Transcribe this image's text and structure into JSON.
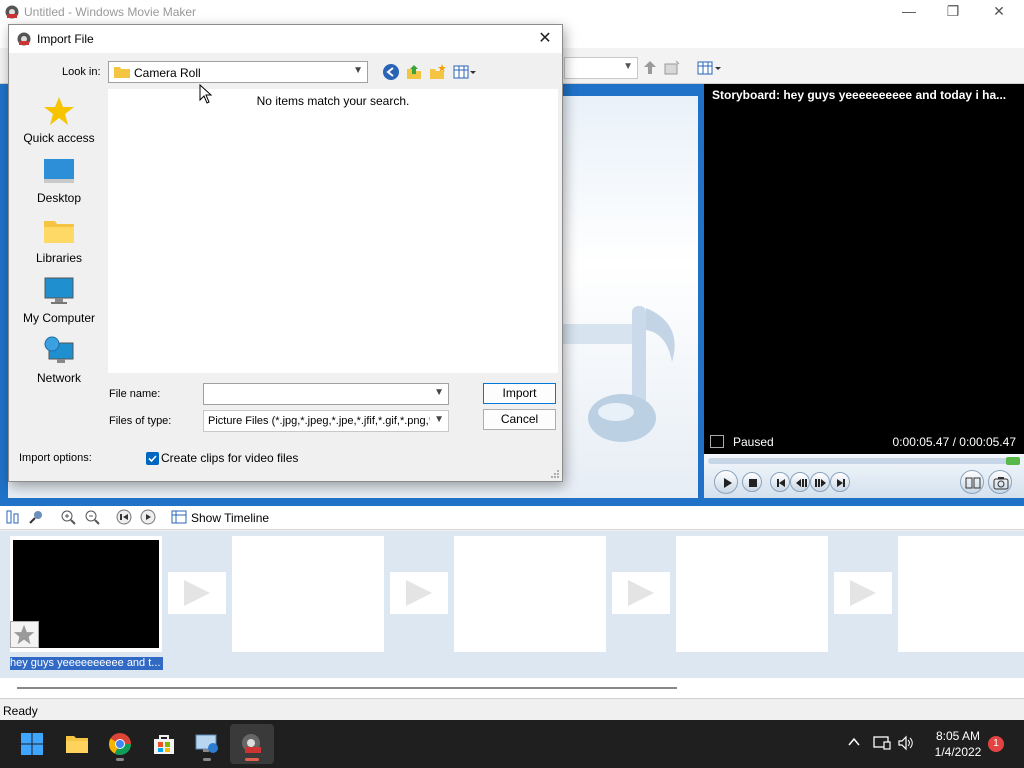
{
  "app": {
    "window_title": "Untitled - Windows Movie Maker",
    "minimize_glyph": "—",
    "maximize_glyph": "❐",
    "close_glyph": "✕"
  },
  "preview": {
    "title": "Storyboard: hey guys yeeeeeeeeee and today i ha...",
    "state": "Paused",
    "time": "0:00:05.47 / 0:00:05.47",
    "progress_fraction": 1.0
  },
  "storyboard": {
    "show_timeline_label": "Show Timeline",
    "clip_label": "hey guys yeeeeeeeeee and t...",
    "empty_slots": 3,
    "transitions": 4
  },
  "status": {
    "text": "Ready"
  },
  "dialog": {
    "title": "Import File",
    "close_glyph": "✕",
    "look_in_label": "Look in:",
    "look_in_value": "Camera Roll",
    "places": [
      {
        "label": "Quick access",
        "icon": "star-icon"
      },
      {
        "label": "Desktop",
        "icon": "desktop-icon"
      },
      {
        "label": "Libraries",
        "icon": "libraries-icon"
      },
      {
        "label": "My Computer",
        "icon": "computer-icon"
      },
      {
        "label": "Network",
        "icon": "network-icon"
      }
    ],
    "empty_message": "No items match your search.",
    "file_name_label": "File name:",
    "file_name_value": "",
    "files_of_type_label": "Files of type:",
    "files_of_type_value": "Picture Files (*.jpg,*.jpeg,*.jpe,*.jfif,*.gif,*.png,*.b",
    "import_button": "Import",
    "cancel_button": "Cancel",
    "import_options_label": "Import options:",
    "create_clips_label": "Create clips for video files",
    "create_clips_checked": true
  },
  "taskbar": {
    "apps": [
      "start",
      "file-explorer",
      "chrome",
      "microsoft-store",
      "remote-desktop",
      "movie-maker"
    ],
    "time": "8:05 AM",
    "date": "1/4/2022",
    "notification_count": "1"
  },
  "colors": {
    "accent_blue": "#1f72c8",
    "selection": "#316ac5",
    "taskbar": "#1f1f1f"
  }
}
